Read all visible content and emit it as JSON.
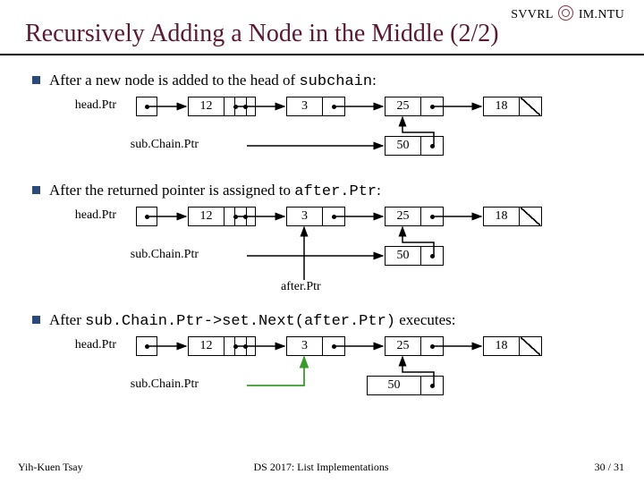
{
  "header": {
    "lab": "SVVRL",
    "dept": "IM.NTU"
  },
  "title": "Recursively Adding a Node in the Middle (2/2)",
  "bullets": {
    "b1_pre": "After a new node is added to the head of ",
    "b1_code": "subchain",
    "b1_post": ":",
    "b2_pre": "After the returned pointer is assigned to ",
    "b2_code": "after.Ptr",
    "b2_post": ":",
    "b3_pre": "After ",
    "b3_code": "sub.Chain.Ptr->set.Next(after.Ptr)",
    "b3_post": " executes:"
  },
  "labels": {
    "headPtr": "head.Ptr",
    "subChainPtr": "sub.Chain.Ptr",
    "afterPtr": "after.Ptr"
  },
  "nodes": {
    "n1": "12",
    "n2": "3",
    "n3": "25",
    "n4": "18",
    "ins": "50"
  },
  "footer": {
    "left": "Yih-Kuen Tsay",
    "center": "DS 2017: List Implementations",
    "right_cur": "30",
    "right_sep": " / ",
    "right_total": "31"
  }
}
